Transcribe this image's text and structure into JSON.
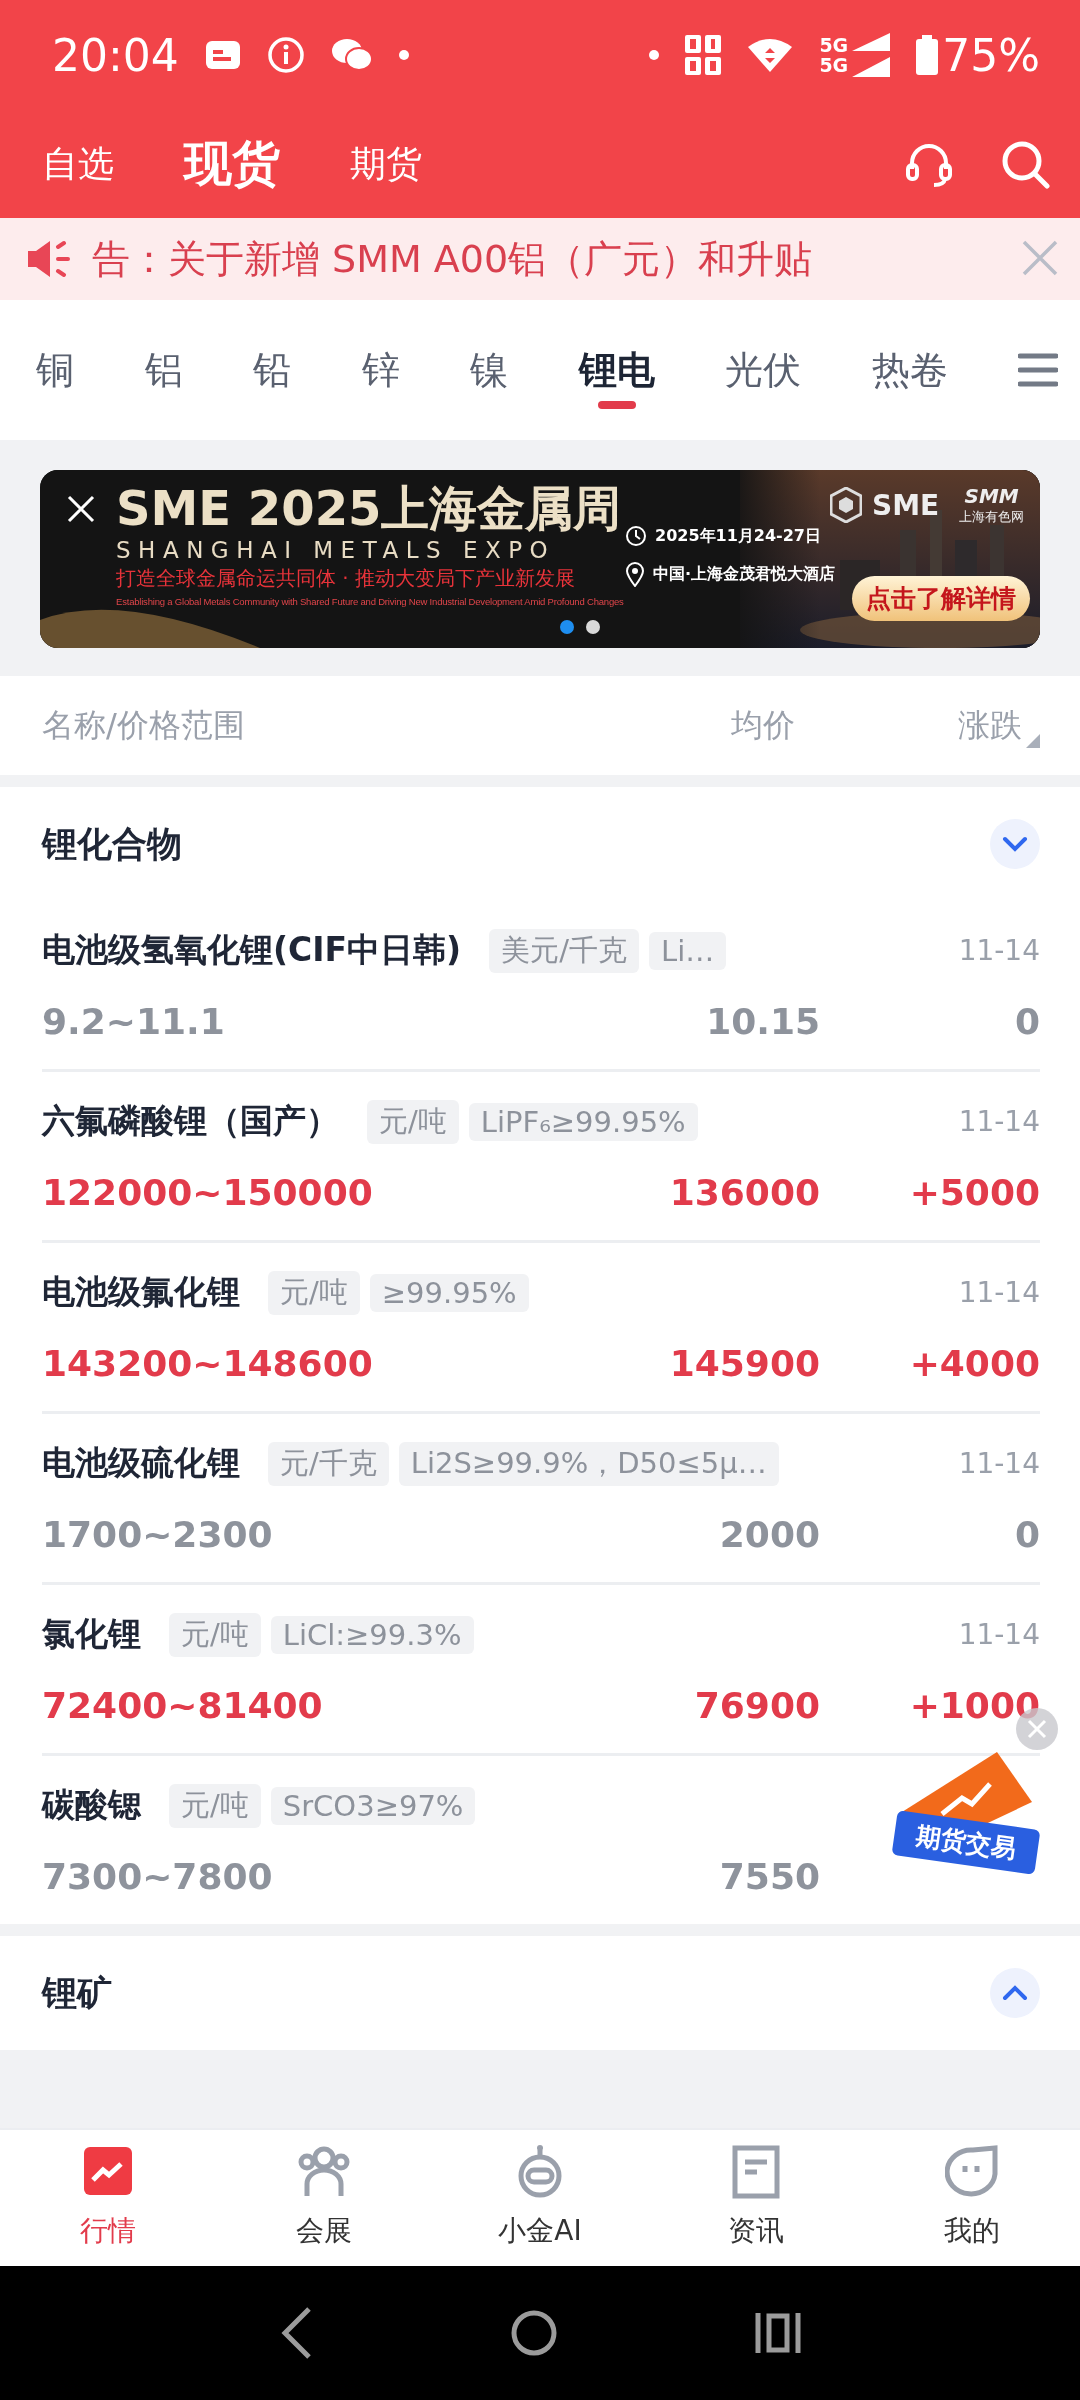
{
  "status_bar": {
    "time": "20:04",
    "network_labels": [
      "5G",
      "5G"
    ],
    "battery": "75%"
  },
  "header": {
    "tabs": [
      {
        "label": "自选",
        "selected": false
      },
      {
        "label": "现货",
        "selected": true
      },
      {
        "label": "期货",
        "selected": false
      }
    ]
  },
  "notice": {
    "text": "告：关于新增 SMM A00铝（广元）和升贴"
  },
  "categories": [
    {
      "label": "铜",
      "selected": false
    },
    {
      "label": "铝",
      "selected": false
    },
    {
      "label": "铅",
      "selected": false
    },
    {
      "label": "锌",
      "selected": false
    },
    {
      "label": "镍",
      "selected": false
    },
    {
      "label": "锂电",
      "selected": true
    },
    {
      "label": "光伏",
      "selected": false
    },
    {
      "label": "热卷",
      "selected": false
    }
  ],
  "banner": {
    "title": "SME 2025上海金属周",
    "subtitle": "SHANGHAI METALS EXPO",
    "slogan": "打造全球金属命运共同体 · 推动大变局下产业新发展",
    "slogan_en": "Establishing a Global Metals Community with Shared Future and Driving New Industrial Development Amid Profound Changes",
    "date": "2025年11月24-27日",
    "venue": "中国·上海金茂君悦大酒店",
    "cta": "点击了解详情",
    "logo_sme": "SME",
    "logo_smm": "SMM",
    "logo_smm_caption": "上海有色网",
    "dots": [
      {
        "selected": true
      },
      {
        "selected": false
      }
    ]
  },
  "columns": {
    "name": "名称/价格范围",
    "average": "均价",
    "change": "涨跌"
  },
  "sections": [
    {
      "title": "锂化合物",
      "expanded": true,
      "rows": [
        {
          "name": "电池级氢氧化锂(CIF中日韩)",
          "tags": [
            "美元/千克",
            "Li…"
          ],
          "date": "11-14",
          "range": "9.2~11.1",
          "average": "10.15",
          "change": "0",
          "rising": false
        },
        {
          "name": "六氟磷酸锂（国产）",
          "tags": [
            "元/吨",
            "LiPF₆≥99.95%"
          ],
          "date": "11-14",
          "range": "122000~150000",
          "average": "136000",
          "change": "+5000",
          "rising": true
        },
        {
          "name": "电池级氟化锂",
          "tags": [
            "元/吨",
            "≥99.95%"
          ],
          "date": "11-14",
          "range": "143200~148600",
          "average": "145900",
          "change": "+4000",
          "rising": true
        },
        {
          "name": "电池级硫化锂",
          "tags": [
            "元/千克",
            "Li2S≥99.9%，D50≤5μ…"
          ],
          "date": "11-14",
          "range": "1700~2300",
          "average": "2000",
          "change": "0",
          "rising": false
        },
        {
          "name": "氯化锂",
          "tags": [
            "元/吨",
            "LiCl:≥99.3%"
          ],
          "date": "11-14",
          "range": "72400~81400",
          "average": "76900",
          "change": "+1000",
          "rising": true
        },
        {
          "name": "碳酸锶",
          "tags": [
            "元/吨",
            "SrCO3≥97%"
          ],
          "range": "7300~7800",
          "average": "7550",
          "rising": false
        }
      ]
    },
    {
      "title": "锂矿",
      "expanded": false
    }
  ],
  "float_ad": {
    "label": "期货交易"
  },
  "bottom_nav": [
    {
      "label": "行情",
      "selected": true
    },
    {
      "label": "会展",
      "selected": false
    },
    {
      "label": "小金AI",
      "selected": false
    },
    {
      "label": "资讯",
      "selected": false
    },
    {
      "label": "我的",
      "selected": false
    }
  ]
}
